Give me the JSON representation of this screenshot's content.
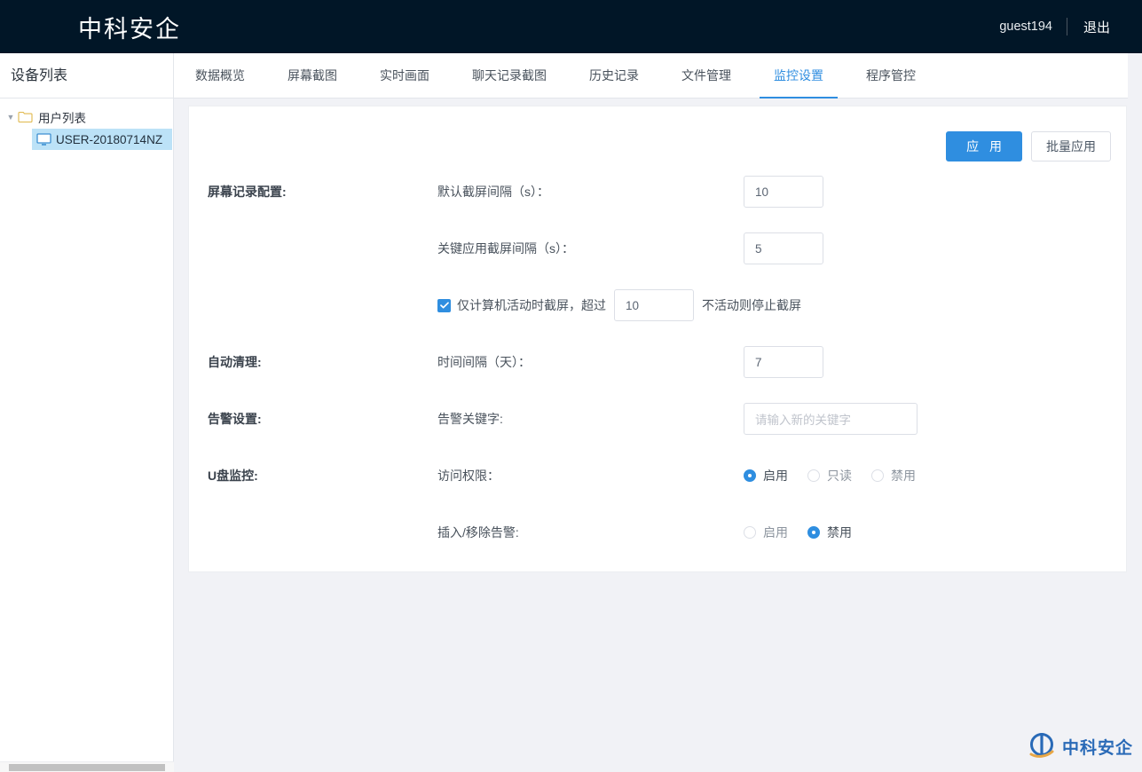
{
  "header": {
    "brand": "中科安企",
    "user": "guest194",
    "logout": "退出"
  },
  "sidebar": {
    "title": "设备列表",
    "tree": {
      "root_label": "用户列表",
      "root_icon": "folder-icon",
      "caret_icon": "caret-down-icon",
      "children": [
        {
          "label": "USER-20180714NZ",
          "icon": "monitor-icon",
          "selected": true
        }
      ]
    }
  },
  "tabs": [
    {
      "label": "数据概览",
      "active": false
    },
    {
      "label": "屏幕截图",
      "active": false
    },
    {
      "label": "实时画面",
      "active": false
    },
    {
      "label": "聊天记录截图",
      "active": false
    },
    {
      "label": "历史记录",
      "active": false
    },
    {
      "label": "文件管理",
      "active": false
    },
    {
      "label": "监控设置",
      "active": true
    },
    {
      "label": "程序管控",
      "active": false
    }
  ],
  "panel": {
    "actions": {
      "apply": "应 用",
      "batch_apply": "批量应用"
    },
    "sections": {
      "screen_record": {
        "label": "屏幕记录配置:",
        "default_interval_label": "默认截屏间隔（s）：",
        "default_interval_value": "10",
        "key_app_interval_label": "关键应用截屏间隔（s）：",
        "key_app_interval_value": "5",
        "active_only_checkbox_label": "仅计算机活动时截屏，超过",
        "active_only_checked": true,
        "idle_minutes_value": "10",
        "active_only_suffix": "不活动则停止截屏"
      },
      "auto_clean": {
        "label": "自动清理:",
        "interval_label": "时间间隔（天）：",
        "interval_value": "7"
      },
      "alarm": {
        "label": "告警设置:",
        "keyword_label": "告警关键字:",
        "keyword_value": "",
        "keyword_placeholder": "请输入新的关键字"
      },
      "usb_monitor": {
        "label": "U盘监控:",
        "access_label": "访问权限：",
        "access_options": [
          {
            "label": "启用",
            "selected": true
          },
          {
            "label": "只读",
            "selected": false
          },
          {
            "label": "禁用",
            "selected": false
          }
        ],
        "plug_alarm_label": "插入/移除告警:",
        "plug_alarm_options": [
          {
            "label": "启用",
            "selected": false
          },
          {
            "label": "禁用",
            "selected": true
          }
        ]
      }
    }
  },
  "watermark": {
    "text": "中科安企",
    "icon": "brand-logo-icon"
  },
  "colors": {
    "header_bg": "#011627",
    "accent": "#2f8ee0",
    "page_bg": "#f1f2f6",
    "selected_row": "#bce2f7"
  }
}
